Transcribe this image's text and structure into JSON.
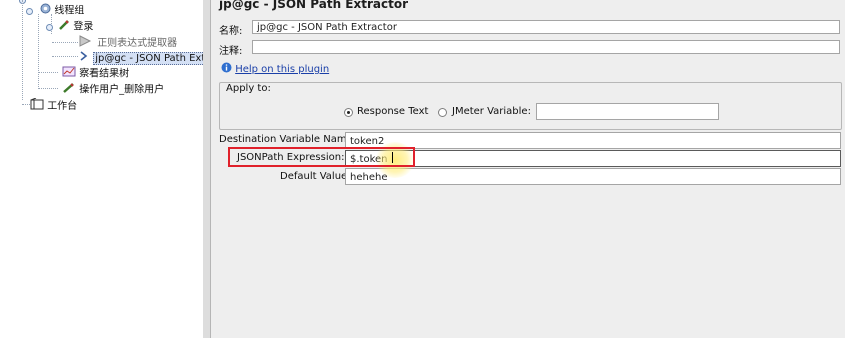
{
  "tree": {
    "items": [
      {
        "label": "线程组"
      },
      {
        "label": "登录"
      },
      {
        "label": "正则表达式提取器"
      },
      {
        "label": "jp@gc - JSON Path Extr"
      },
      {
        "label": "察看结果树"
      },
      {
        "label": "操作用户_删除用户"
      },
      {
        "label": "工作台"
      }
    ]
  },
  "panel": {
    "title": "jp@gc - JSON Path Extractor",
    "name_label": "名称:",
    "name_value": "jp@gc - JSON Path Extractor",
    "comment_label": "注释:",
    "comment_value": "",
    "help_link": "Help on this plugin",
    "apply_to": {
      "legend": "Apply to:",
      "options": [
        {
          "label": "Response Text",
          "selected": true
        },
        {
          "label": "JMeter Variable:",
          "selected": false
        }
      ],
      "variable_value": ""
    },
    "fields": [
      {
        "label": "Destination Variable Name:",
        "value": "token2"
      },
      {
        "label": "JSONPath Expression:",
        "value": "$.token"
      },
      {
        "label": "Default Value:",
        "value": "hehehe"
      }
    ]
  },
  "colors": {
    "highlight": "#e0202a",
    "link": "#1a3fa8",
    "selected_row": "#d4e0f5"
  }
}
